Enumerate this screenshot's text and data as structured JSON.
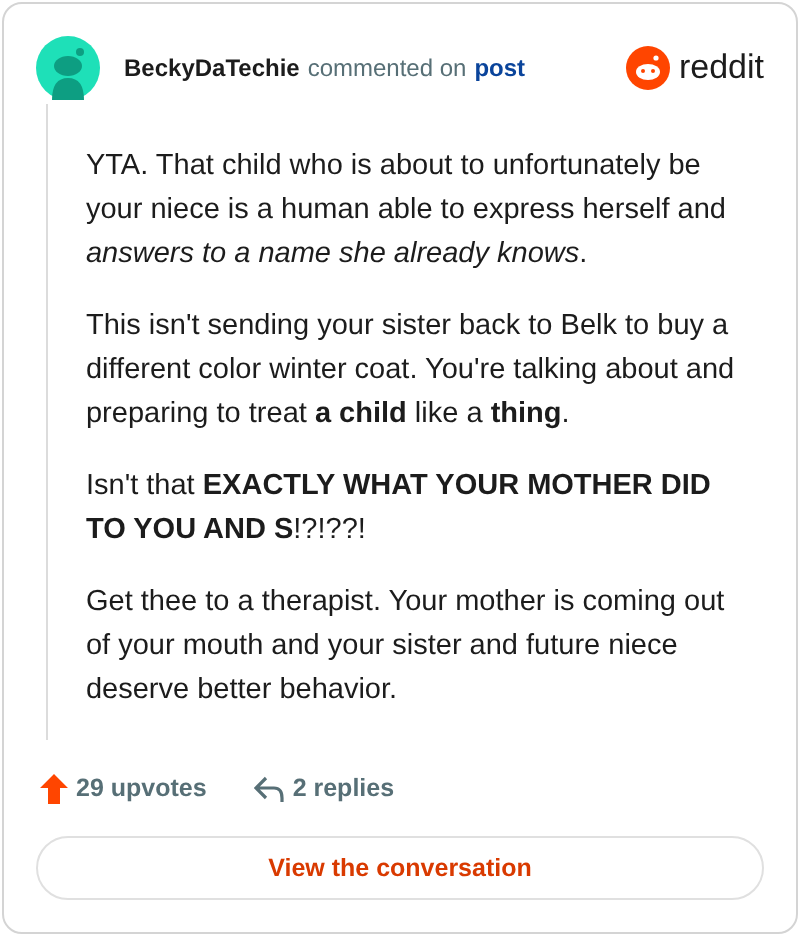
{
  "comment": {
    "author": "BeckyDaTechie",
    "action": "commented on",
    "link": "post",
    "brand": "reddit",
    "paragraphs": [
      "YTA. That child who is about to unfortunately be your niece is a human able to express herself and *answers to a name she already knows*.",
      "This isn't sending your sister back to Belk to buy a different color winter coat. You're talking about and preparing to treat **a child** like a **thing**.",
      "Isn't that **EXACTLY WHAT YOUR MOTHER DID TO YOU AND S**!?!??!",
      "Get thee to a therapist. Your mother is coming out of your mouth and your sister and future niece deserve better behavior."
    ],
    "upvotes": "29 upvotes",
    "replies": "2 replies",
    "button": "View the conversation"
  }
}
